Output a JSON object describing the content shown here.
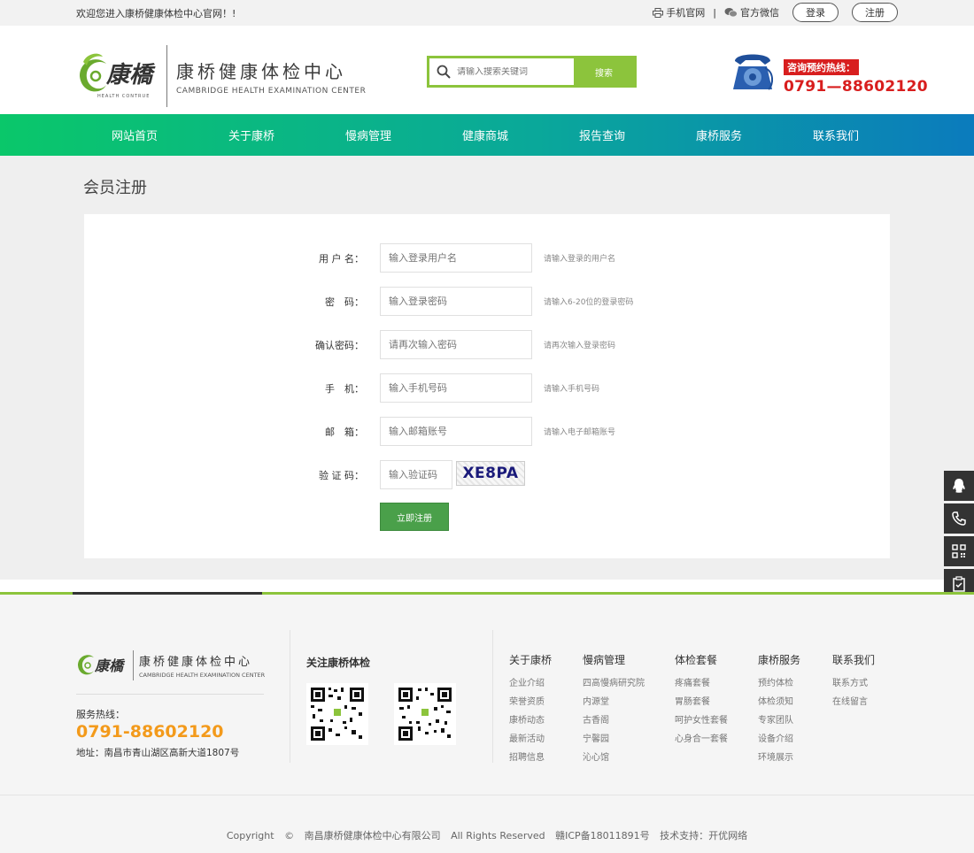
{
  "topbar": {
    "welcome": "欢迎您进入康桥健康体检中心官网！!",
    "mobile_site": "手机官网",
    "separator": "|",
    "wechat": "官方微信",
    "login": "登录",
    "register": "注册"
  },
  "header": {
    "logo_cn": "康桥健康体检中心",
    "logo_en": "CAMBRIDGE HEALTH EXAMINATION CENTER",
    "logo_mark_text": "康橋",
    "logo_mark_sub": "HEALTH CONTRUE",
    "search_placeholder": "请输入搜索关键词",
    "search_button": "搜索",
    "hotline_label": "咨询预约热线：",
    "hotline_number": "0791—88602120"
  },
  "nav": {
    "items": [
      "网站首页",
      "关于康桥",
      "慢病管理",
      "健康商城",
      "报告查询",
      "康桥服务",
      "联系我们"
    ]
  },
  "register": {
    "title": "会员注册",
    "fields": [
      {
        "label": "用 户 名：",
        "placeholder": "输入登录用户名",
        "hint": "请输入登录的用户名"
      },
      {
        "label": "密　码：",
        "placeholder": "输入登录密码",
        "hint": "请输入6-20位的登录密码"
      },
      {
        "label": "确认密码：",
        "placeholder": "请再次输入密码",
        "hint": "请再次输入登录密码"
      },
      {
        "label": "手　机：",
        "placeholder": "输入手机号码",
        "hint": "请输入手机号码"
      },
      {
        "label": "邮　箱：",
        "placeholder": "输入邮箱账号",
        "hint": "请输入电子邮箱账号"
      }
    ],
    "captcha_label": "验 证 码：",
    "captcha_placeholder": "输入验证码",
    "captcha_text": "XE8PA",
    "submit": "立即注册"
  },
  "footer": {
    "logo_cn": "康桥健康体检中心",
    "logo_en": "CAMBRIDGE HEALTH EXAMINATION CENTER",
    "hotline_label": "服务热线：",
    "hotline_number": "0791-88602120",
    "address": "地址：南昌市青山湖区高新大道1807号",
    "follow": "关注康桥体检",
    "columns": [
      {
        "title": "关于康桥",
        "links": [
          "企业介绍",
          "荣誉资质",
          "康桥动态",
          "最新活动",
          "招聘信息"
        ]
      },
      {
        "title": "慢病管理",
        "links": [
          "四高慢病研究院",
          "内源堂",
          "古香阁",
          "宁馨园",
          "沁心馆"
        ]
      },
      {
        "title": "体检套餐",
        "links": [
          "疼痛套餐",
          "胃肠套餐",
          "呵护女性套餐",
          "心身合一套餐"
        ]
      },
      {
        "title": "康桥服务",
        "links": [
          "预约体检",
          "体检须知",
          "专家团队",
          "设备介绍",
          "环境展示"
        ]
      },
      {
        "title": "联系我们",
        "links": [
          "联系方式",
          "在线留言"
        ]
      }
    ],
    "copyright": "Copyright",
    "copyright_symbol": "©",
    "company": "南昌康桥健康体检中心有限公司",
    "rights": "All Rights Reserved",
    "icp": "赣ICP备18011891号",
    "tech": "技术支持：开优网络"
  },
  "colors": {
    "accent_green": "#8cc43c",
    "hotline_red": "#d81e1e",
    "hotline_orange": "#f39a1b",
    "button_green": "#4aa04a"
  },
  "icons": {
    "side_tools": [
      "qq-icon",
      "phone-icon",
      "qrcode-icon",
      "clipboard-icon"
    ]
  }
}
